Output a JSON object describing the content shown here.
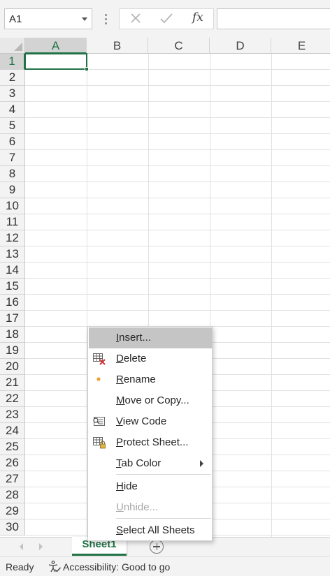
{
  "formula_bar": {
    "name_box_value": "A1",
    "cancel_icon": "close-icon",
    "enter_icon": "check-icon",
    "function_label": "fx",
    "formula_value": ""
  },
  "grid": {
    "columns": [
      "A",
      "B",
      "C",
      "D",
      "E"
    ],
    "rows": [
      "1",
      "2",
      "3",
      "4",
      "5",
      "6",
      "7",
      "8",
      "9",
      "10",
      "11",
      "12",
      "13",
      "14",
      "15",
      "16",
      "17",
      "18",
      "19",
      "20",
      "21",
      "22",
      "23",
      "24",
      "25",
      "26",
      "27",
      "28",
      "29",
      "30"
    ],
    "selected_cell": "A1"
  },
  "context_menu": {
    "insert": {
      "mnemonic": "I",
      "rest": "nsert..."
    },
    "delete": {
      "mnemonic": "D",
      "rest": "elete"
    },
    "rename": {
      "mnemonic": "R",
      "rest": "ename"
    },
    "move_copy": {
      "mnemonic": "M",
      "rest": "ove or Copy..."
    },
    "view_code": {
      "mnemonic": "V",
      "rest": "iew Code"
    },
    "protect": {
      "mnemonic": "P",
      "rest": "rotect Sheet..."
    },
    "tab_color": {
      "mnemonic": "T",
      "rest": "ab Color"
    },
    "hide": {
      "mnemonic": "H",
      "rest": "ide"
    },
    "unhide": {
      "mnemonic": "U",
      "rest": "nhide..."
    },
    "select_all": {
      "mnemonic": "S",
      "rest": "elect All Sheets"
    }
  },
  "sheet_tabs": {
    "active_tab": "Sheet1",
    "add_icon": "plus-circle-icon"
  },
  "status_bar": {
    "ready": "Ready",
    "accessibility": "Accessibility: Good to go"
  },
  "colors": {
    "accent": "#217346",
    "menu_highlight": "#c5c5c5",
    "rename_dot": "#f0a030"
  }
}
